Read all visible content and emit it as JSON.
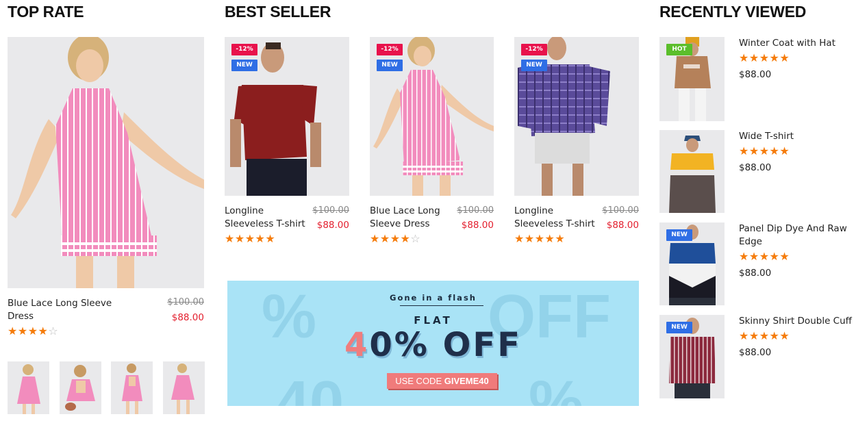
{
  "sections": {
    "top_rate": "TOP RATE",
    "best_seller": "BEST SELLER",
    "recently_viewed": "RECENTLY VIEWED"
  },
  "badges": {
    "sale": "-12%",
    "new": "NEW",
    "hot": "HOT"
  },
  "top_rate": {
    "name": "Blue Lace Long Sleeve Dress",
    "old_price": "$100.00",
    "price": "$88.00",
    "rating": 4
  },
  "best_seller": [
    {
      "name": "Longline Sleeveless T-shirt",
      "old_price": "$100.00",
      "price": "$88.00",
      "rating": 5
    },
    {
      "name": "Blue Lace Long Sleeve Dress",
      "old_price": "$100.00",
      "price": "$88.00",
      "rating": 4
    },
    {
      "name": "Longline Sleeveless T-shirt",
      "old_price": "$100.00",
      "price": "$88.00",
      "rating": 5
    }
  ],
  "banner": {
    "tagline": "Gone in a flash",
    "flat": "FLAT",
    "discount_num": "4",
    "discount_rest": "0% OFF",
    "code_prefix": "USE CODE ",
    "code": "GIVEME40"
  },
  "recently_viewed": [
    {
      "name": "Winter Coat with Hat",
      "price": "$88.00",
      "rating": 5,
      "badge": "HOT"
    },
    {
      "name": "Wide T-shirt",
      "price": "$88.00",
      "rating": 5,
      "badge": ""
    },
    {
      "name": "Panel Dip Dye And Raw Edge",
      "price": "$88.00",
      "rating": 5,
      "badge": "NEW"
    },
    {
      "name": "Skinny Shirt Double Cuff",
      "price": "$88.00",
      "rating": 5,
      "badge": "NEW"
    }
  ],
  "colors": {
    "sale_badge": "#e8124c",
    "new_badge": "#2f6ee5",
    "hot_badge": "#5bbe2b",
    "price": "#e31e2d",
    "star": "#f57c0c",
    "banner_bg": "#a9e3f6"
  },
  "icons": {
    "star_filled": "★",
    "star_empty": "☆"
  }
}
